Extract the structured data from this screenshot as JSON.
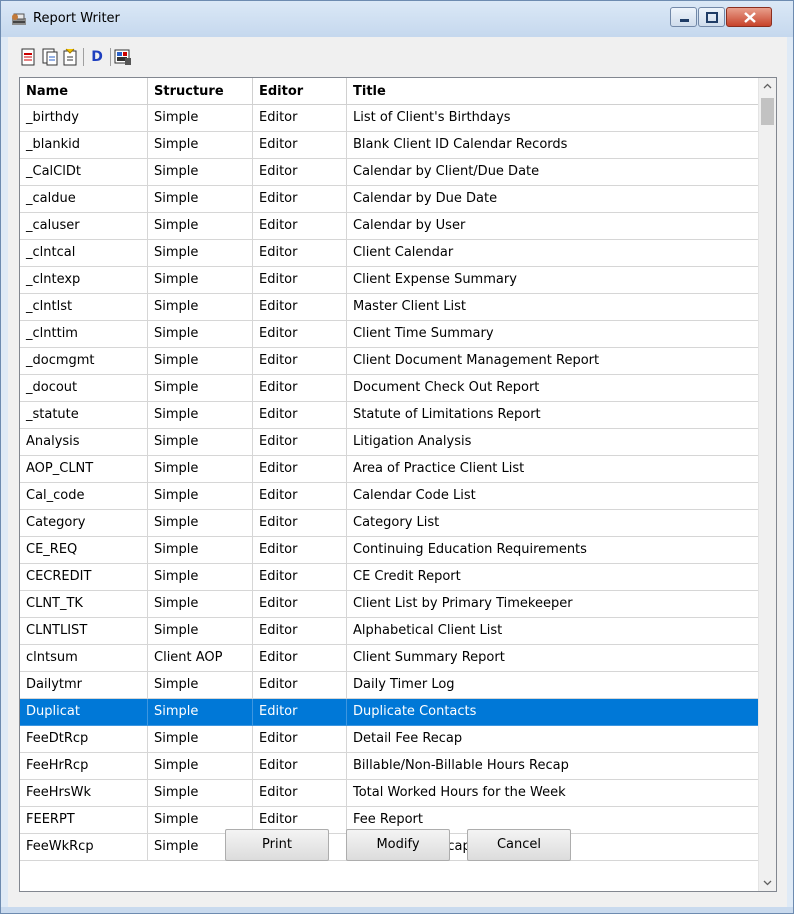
{
  "window": {
    "title": "Report Writer",
    "controls": {
      "minimize": "minimize",
      "maximize": "maximize",
      "close": "close"
    }
  },
  "toolbar": {
    "buttons": [
      {
        "icon": "new-report-icon"
      },
      {
        "icon": "copy-report-icon"
      },
      {
        "icon": "open-report-icon"
      },
      {
        "icon": "design-d-icon",
        "label": "D"
      },
      {
        "icon": "properties-icon"
      }
    ]
  },
  "table": {
    "columns": [
      "Name",
      "Structure",
      "Editor",
      "Title"
    ],
    "selected_index": 23,
    "rows": [
      [
        "_birthdy",
        "Simple",
        "Editor",
        "List of Client's Birthdays"
      ],
      [
        "_blankid",
        "Simple",
        "Editor",
        "Blank Client ID Calendar Records"
      ],
      [
        "_CalClDt",
        "Simple",
        "Editor",
        "Calendar by Client/Due Date"
      ],
      [
        "_caldue",
        "Simple",
        "Editor",
        "Calendar by Due Date"
      ],
      [
        "_caluser",
        "Simple",
        "Editor",
        "Calendar by User"
      ],
      [
        "_clntcal",
        "Simple",
        "Editor",
        "Client Calendar"
      ],
      [
        "_clntexp",
        "Simple",
        "Editor",
        "Client Expense Summary"
      ],
      [
        "_clntlst",
        "Simple",
        "Editor",
        "Master Client List"
      ],
      [
        "_clnttim",
        "Simple",
        "Editor",
        "Client Time Summary"
      ],
      [
        "_docmgmt",
        "Simple",
        "Editor",
        "Client Document Management Report"
      ],
      [
        "_docout",
        "Simple",
        "Editor",
        "Document Check Out Report"
      ],
      [
        "_statute",
        "Simple",
        "Editor",
        "Statute of Limitations Report"
      ],
      [
        "Analysis",
        "Simple",
        "Editor",
        "Litigation Analysis"
      ],
      [
        "AOP_CLNT",
        "Simple",
        "Editor",
        "Area of Practice Client List"
      ],
      [
        "Cal_code",
        "Simple",
        "Editor",
        "Calendar Code List"
      ],
      [
        "Category",
        "Simple",
        "Editor",
        "Category List"
      ],
      [
        "CE_REQ",
        "Simple",
        "Editor",
        "Continuing Education Requirements"
      ],
      [
        "CECREDIT",
        "Simple",
        "Editor",
        "CE Credit Report"
      ],
      [
        "CLNT_TK",
        "Simple",
        "Editor",
        "Client List by Primary Timekeeper"
      ],
      [
        "CLNTLIST",
        "Simple",
        "Editor",
        "Alphabetical Client List"
      ],
      [
        "clntsum",
        "Client AOP",
        "Editor",
        "Client Summary Report"
      ],
      [
        "Dailytmr",
        "Simple",
        "Editor",
        "Daily Timer Log"
      ],
      [
        "Duplicat",
        "Simple",
        "Editor",
        "Duplicate Contacts"
      ],
      [
        "FeeDtRcp",
        "Simple",
        "Editor",
        "Detail Fee Recap"
      ],
      [
        "FeeHrRcp",
        "Simple",
        "Editor",
        "Billable/Non-Billable Hours Recap"
      ],
      [
        "FeeHrsWk",
        "Simple",
        "Editor",
        "Total Worked Hours for the Week"
      ],
      [
        "FEERPT",
        "Simple",
        "Editor",
        "Fee Report"
      ],
      [
        "FeeWkRcp",
        "Simple",
        "Editor",
        "Weekly Fee Recap"
      ]
    ]
  },
  "buttons": {
    "print": "Print",
    "modify": "Modify",
    "cancel": "Cancel"
  },
  "colors": {
    "selection": "#0078d7",
    "close_button": "#c7432b"
  }
}
